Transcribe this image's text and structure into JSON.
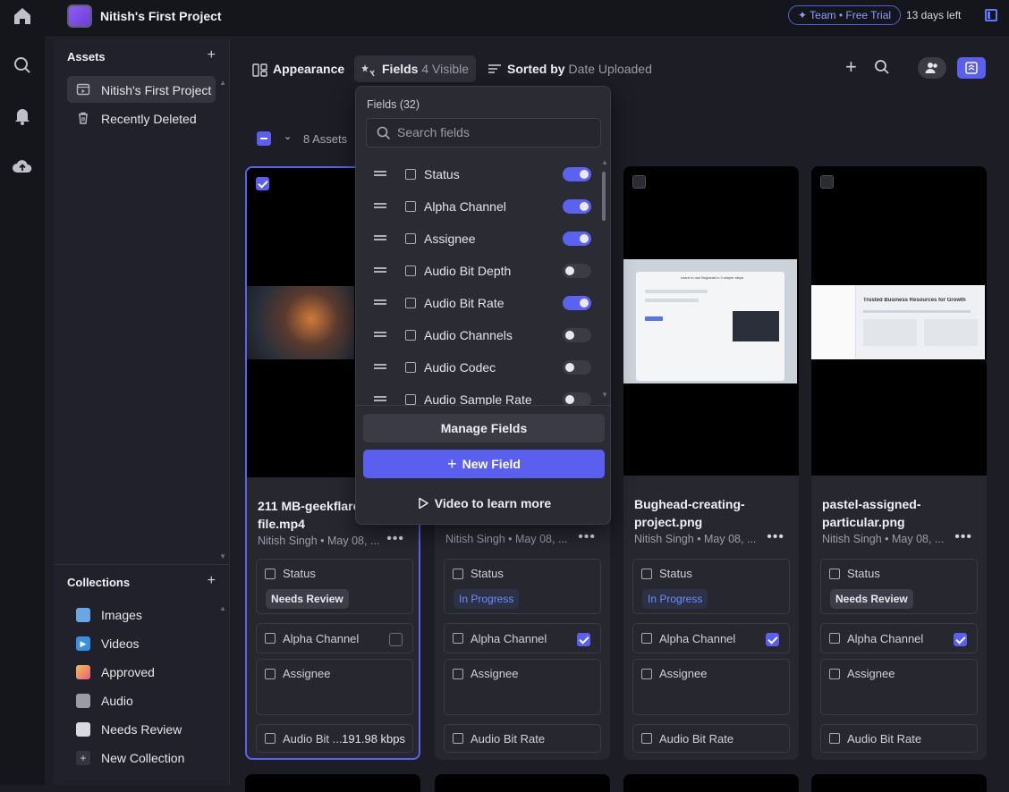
{
  "topbar": {
    "project_name": "Nitish's First Project",
    "trial_label": "✦ Team • Free Trial",
    "days_left": "13 days left"
  },
  "sidebar": {
    "assets_heading": "Assets",
    "assets_items": [
      {
        "label": "Nitish's First Project",
        "icon": "project-icon"
      },
      {
        "label": "Recently Deleted",
        "icon": "trash-icon"
      }
    ],
    "collections_heading": "Collections",
    "collections": [
      {
        "label": "Images",
        "icon": "image-icon"
      },
      {
        "label": "Videos",
        "icon": "video-icon"
      },
      {
        "label": "Approved",
        "icon": "party-icon"
      },
      {
        "label": "Audio",
        "icon": "speaker-icon"
      },
      {
        "label": "Needs Review",
        "icon": "eyes-icon"
      },
      {
        "label": "New Collection",
        "icon": "plus-icon"
      }
    ]
  },
  "toolbar": {
    "appearance_label": "Appearance",
    "fields_label": "Fields",
    "fields_visible": "4 Visible",
    "sorted_label": "Sorted by",
    "sorted_value": "Date Uploaded",
    "asset_count": "8 Assets"
  },
  "dropdown": {
    "title": "Fields (32)",
    "search_placeholder": "Search fields",
    "fields": [
      {
        "label": "Status",
        "on": true
      },
      {
        "label": "Alpha Channel",
        "on": true
      },
      {
        "label": "Assignee",
        "on": true
      },
      {
        "label": "Audio Bit Depth",
        "on": false
      },
      {
        "label": "Audio Bit Rate",
        "on": true
      },
      {
        "label": "Audio Channels",
        "on": false
      },
      {
        "label": "Audio Codec",
        "on": false
      },
      {
        "label": "Audio Sample Rate",
        "on": false
      }
    ],
    "manage_label": "Manage Fields",
    "new_field_label": "New Field",
    "video_label": "Video to learn more"
  },
  "cards": [
    {
      "title": "211 MB-geekflare-test-file.mp4",
      "meta": "Nitish Singh • May 08, ...",
      "status": "Needs Review",
      "alpha": false,
      "bitrate_label": "Audio Bit ...",
      "bitrate_value": "191.98 kbps",
      "selected": true
    },
    {
      "title": "",
      "meta": "Nitish Singh • May 08, ...",
      "status": "In Progress",
      "alpha": true,
      "bitrate_label": "Audio Bit Rate",
      "bitrate_value": "",
      "selected": false
    },
    {
      "title": "Bughead-creating-project.png",
      "meta": "Nitish Singh • May 08, ...",
      "status": "In Progress",
      "alpha": true,
      "bitrate_label": "Audio Bit Rate",
      "bitrate_value": "",
      "selected": false
    },
    {
      "title": "pastel-assigned-particular.png",
      "meta": "Nitish Singh • May 08, ...",
      "status": "Needs Review",
      "alpha": true,
      "bitrate_label": "Audio Bit Rate",
      "bitrate_value": "",
      "selected": false
    }
  ],
  "field_labels": {
    "status": "Status",
    "alpha": "Alpha Channel",
    "assignee": "Assignee"
  },
  "thumb_texts": {
    "bughead_heading": "Learn to use Bughead in 3 simple steps",
    "pastel_heading": "Trusted Business Resources for Growth"
  },
  "colors": {
    "accent": "#5b5ff0",
    "background": "#1c1d25",
    "panel": "#20212a"
  }
}
